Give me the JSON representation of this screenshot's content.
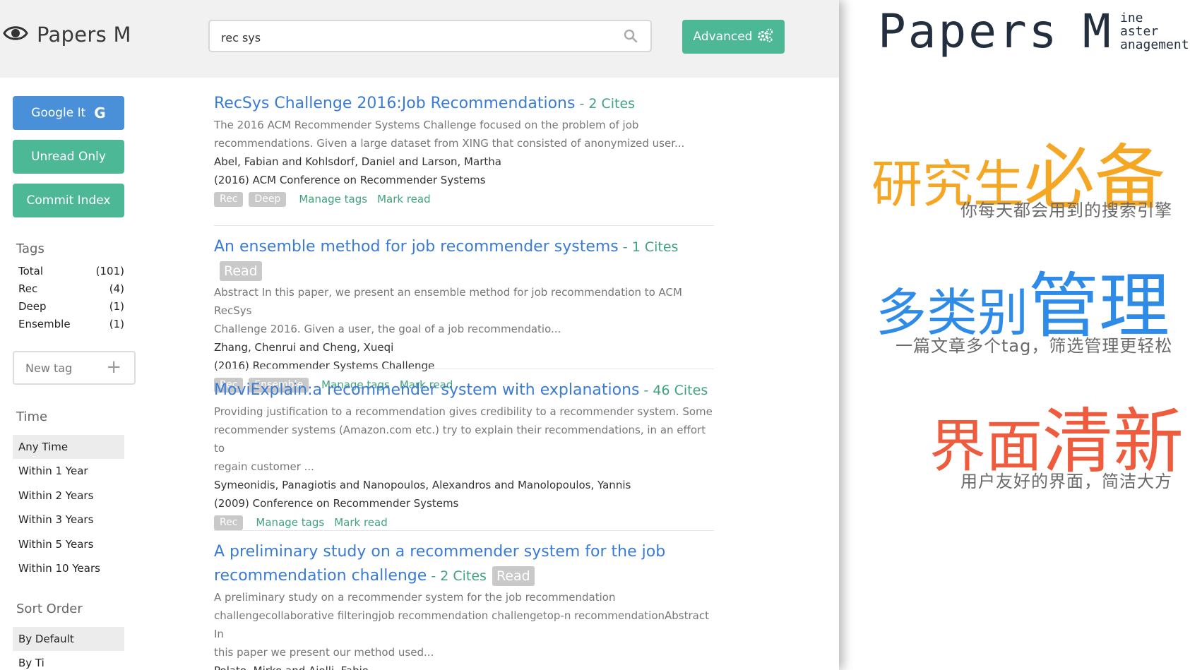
{
  "brand": {
    "name": "Papers M"
  },
  "search": {
    "value": "rec sys"
  },
  "advanced": {
    "label": "Advanced"
  },
  "sidebar": {
    "google_label": "Google It",
    "unread_label": "Unread Only",
    "commit_label": "Commit Index",
    "tags_title": "Tags",
    "tags": [
      {
        "name": "Total",
        "count": "(101)"
      },
      {
        "name": "Rec",
        "count": "(4)"
      },
      {
        "name": "Deep",
        "count": "(1)"
      },
      {
        "name": "Ensemble",
        "count": "(1)"
      }
    ],
    "new_tag_placeholder": "New tag",
    "time_title": "Time",
    "time_options": [
      "Any Time",
      "Within 1 Year",
      "Within 2 Years",
      "Within 3 Years",
      "Within 5 Years",
      "Within 10 Years"
    ],
    "sort_title": "Sort Order",
    "sort_options": [
      "By Default",
      "By Ti"
    ]
  },
  "results": [
    {
      "title": "RecSys Challenge 2016:Job Recommendations",
      "cites": " - 2 Cites",
      "read": "",
      "abstract": [
        "The 2016 ACM Recommender Systems Challenge focused on the problem of job",
        "recommendations. Given a large dataset from XING that consisted of anonymized user..."
      ],
      "authors": "Abel, Fabian and Kohlsdorf, Daniel and Larson, Martha",
      "venue": "(2016) ACM Conference on Recommender Systems",
      "tags": [
        "Rec",
        "Deep"
      ],
      "manage_label": "Manage tags",
      "mark_label": "Mark read"
    },
    {
      "title": "An ensemble method for job recommender systems",
      "cites": " - 1 Cites",
      "read": "Read",
      "abstract": [
        "Abstract In this paper, we present an ensemble method for job recommendation to ACM RecSys",
        "Challenge 2016. Given a user, the goal of a job recommendatio..."
      ],
      "authors": "Zhang, Chenrui and Cheng, Xueqi",
      "venue": "(2016) Recommender Systems Challenge",
      "tags": [
        "Rec",
        "Ensemble"
      ],
      "manage_label": "Manage tags",
      "mark_label": "Mark read"
    },
    {
      "title": "MoviExplain:a recommender system with explanations",
      "cites": " - 46 Cites",
      "read": "",
      "abstract": [
        "Providing justification to a recommendation gives credibility to a recommender system. Some",
        "recommender systems (Amazon.com etc.) try to explain their recommendations, in an effort to",
        "regain customer ..."
      ],
      "authors": "Symeonidis, Panagiotis and Nanopoulos, Alexandros and Manolopoulos, Yannis",
      "venue": "(2009) Conference on Recommender Systems",
      "tags": [
        "Rec"
      ],
      "manage_label": "Manage tags",
      "mark_label": "Mark read"
    },
    {
      "title_line1": "A preliminary study on a recommender system for the job",
      "title_line2": "recommendation challenge",
      "cites": " - 2 Cites",
      "read": "Read",
      "abstract": [
        "A preliminary study on a recommender system for the job recommendation",
        "challengecollaborative filteringjob recommendation challengetop-n recommendationAbstract In",
        "this paper we present our method used..."
      ],
      "authors": "Polato, Mirko and Aiolli, Fabio"
    }
  ],
  "promo": {
    "title": "Papers",
    "m": "M",
    "sub": [
      "ine",
      "aster",
      "anagement"
    ],
    "slogan1_a": "研究生",
    "slogan1_b": "必备",
    "slogan1_sub": "你每天都会用到的搜索引擎",
    "slogan2_a": "多类别",
    "slogan2_b": "管理",
    "slogan2_sub": "一篇文章多个tag，筛选管理更轻松",
    "slogan3_a": "界面",
    "slogan3_b": "清新",
    "slogan3_sub": "用户友好的界面，简洁大方",
    "colors": {
      "orange": "#f5a623",
      "blue": "#2e8be8",
      "red": "#ee5b3d"
    }
  }
}
